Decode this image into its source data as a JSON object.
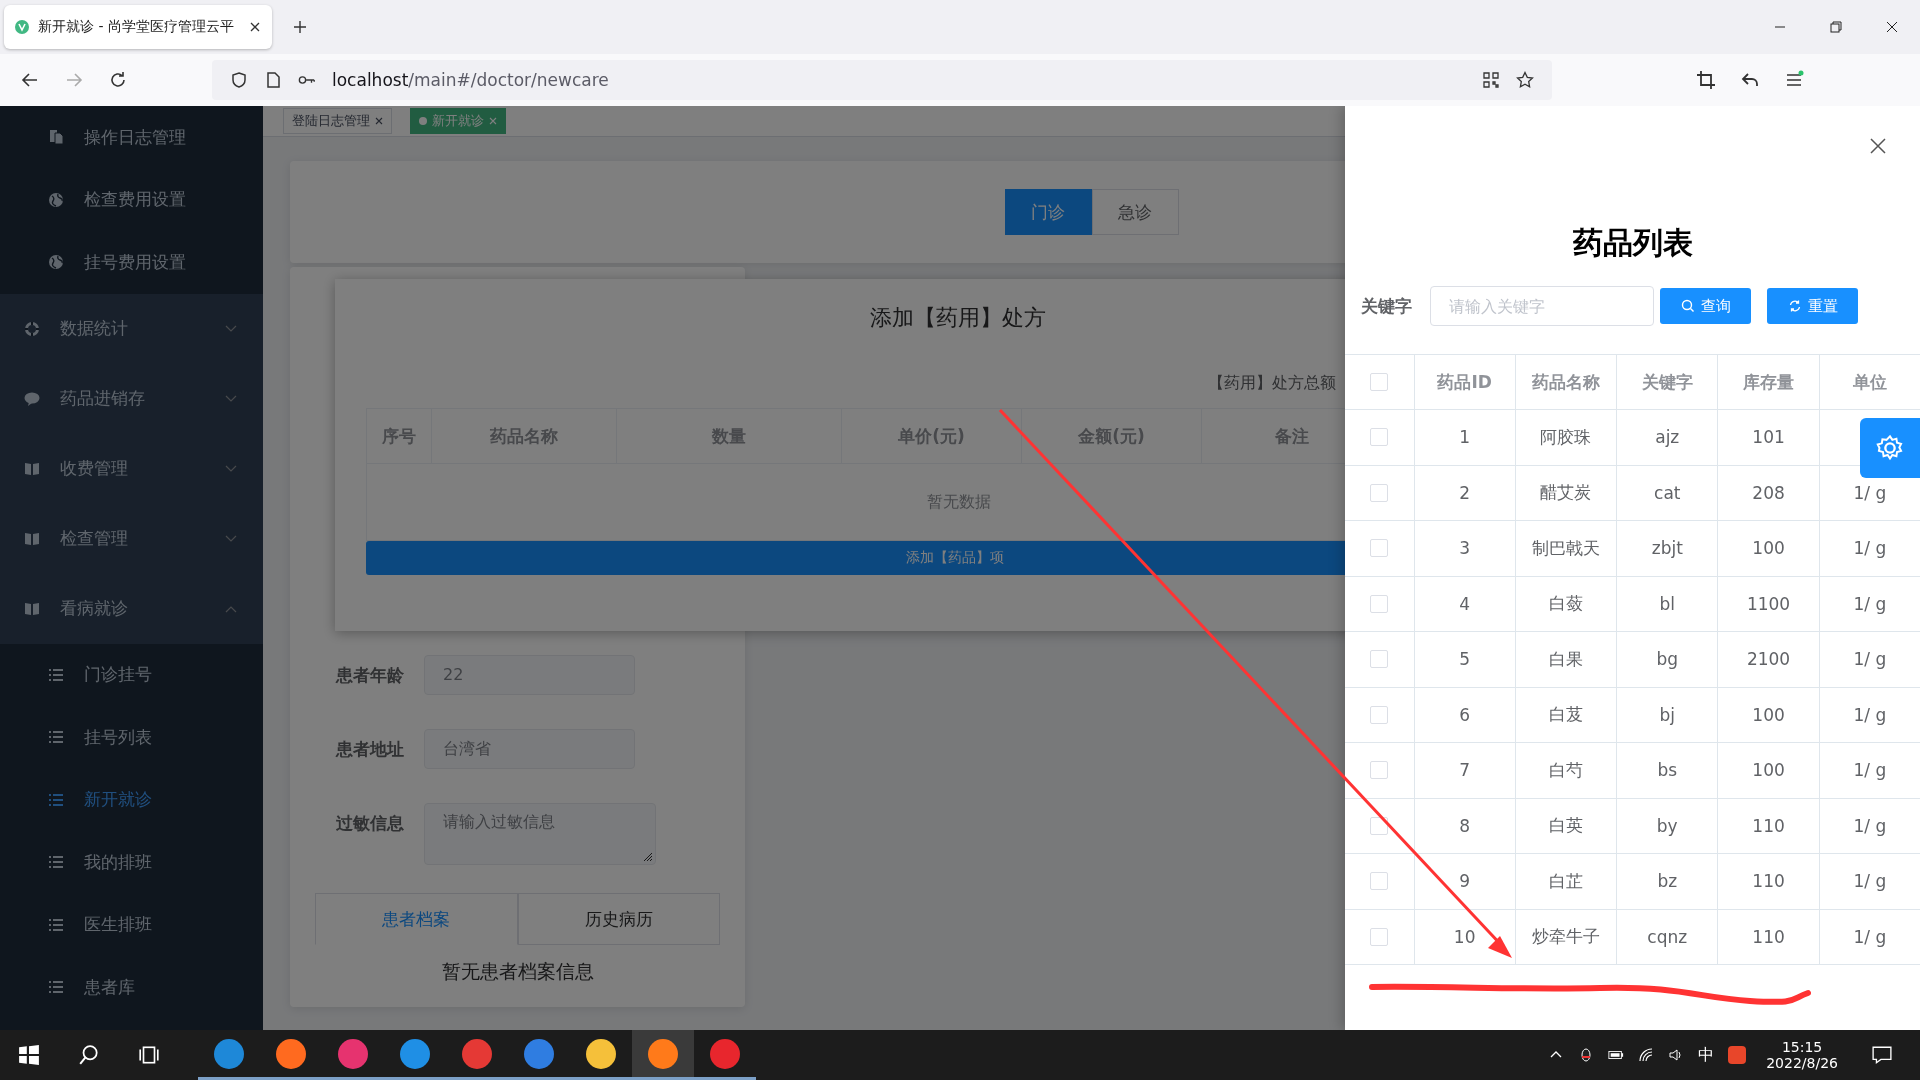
{
  "browser": {
    "tab_title": "新开就诊 - 尚学堂医疗管理云平",
    "url_host": "localhost",
    "url_path": "/main#/doctor/newcare"
  },
  "sidebar": {
    "items": [
      {
        "kind": "sub",
        "label": "操作日志管理",
        "selected": false
      },
      {
        "kind": "sub",
        "label": "检查费用设置",
        "selected": false
      },
      {
        "kind": "sub",
        "label": "挂号费用设置",
        "selected": false
      },
      {
        "kind": "group",
        "label": "数据统计",
        "expanded": false
      },
      {
        "kind": "group",
        "label": "药品进销存",
        "expanded": false
      },
      {
        "kind": "group",
        "label": "收费管理",
        "expanded": false
      },
      {
        "kind": "group",
        "label": "检查管理",
        "expanded": false
      },
      {
        "kind": "group",
        "label": "看病就诊",
        "expanded": true
      },
      {
        "kind": "sub",
        "label": "门诊挂号",
        "selected": false
      },
      {
        "kind": "sub",
        "label": "挂号列表",
        "selected": false
      },
      {
        "kind": "sub",
        "label": "新开就诊",
        "selected": true
      },
      {
        "kind": "sub",
        "label": "我的排班",
        "selected": false
      },
      {
        "kind": "sub",
        "label": "医生排班",
        "selected": false
      },
      {
        "kind": "sub",
        "label": "患者库",
        "selected": false
      }
    ]
  },
  "tags": [
    {
      "label": "登陆日志管理",
      "selected": false
    },
    {
      "label": "新开就诊",
      "selected": true
    }
  ],
  "visit_types": [
    {
      "label": "门诊",
      "selected": true
    },
    {
      "label": "急诊",
      "selected": false
    }
  ],
  "prescription_dialog": {
    "title": "添加【药用】处方",
    "total_label": "【药用】处方总额",
    "columns": [
      "序号",
      "药品名称",
      "数量",
      "单价(元)",
      "金额(元)",
      "备注"
    ],
    "empty_text": "暂无数据",
    "add_button": "添加【药品】项"
  },
  "patient_form": {
    "fields": [
      {
        "kind": "input",
        "label": "患者年龄",
        "value": "22"
      },
      {
        "kind": "input",
        "label": "患者地址",
        "value": "台湾省"
      },
      {
        "kind": "textarea",
        "label": "过敏信息",
        "placeholder": "请输入过敏信息"
      }
    ]
  },
  "patient_tabs": [
    {
      "label": "患者档案",
      "selected": true
    },
    {
      "label": "历史病历",
      "selected": false
    }
  ],
  "patient_empty_text": "暂无患者档案信息",
  "drawer": {
    "title": "药品列表",
    "search_label": "关键字",
    "search_placeholder": "请输入关键字",
    "buttons": [
      {
        "kind": "search",
        "label": "查询"
      },
      {
        "kind": "reset",
        "label": "重置"
      }
    ],
    "header_checked": false,
    "columns": [
      "药品ID",
      "药品名称",
      "关键字",
      "库存量",
      "单位"
    ],
    "rows": [
      {
        "checked": false,
        "cells": [
          "1",
          "阿胶珠",
          "ajz",
          "101",
          ""
        ]
      },
      {
        "checked": false,
        "cells": [
          "2",
          "醋艾炭",
          "cat",
          "208",
          "1/ g"
        ]
      },
      {
        "checked": false,
        "cells": [
          "3",
          "制巴戟天",
          "zbjt",
          "100",
          "1/ g"
        ]
      },
      {
        "checked": false,
        "cells": [
          "4",
          "白蔹",
          "bl",
          "1100",
          "1/ g"
        ]
      },
      {
        "checked": false,
        "cells": [
          "5",
          "白果",
          "bg",
          "2100",
          "1/ g"
        ]
      },
      {
        "checked": false,
        "cells": [
          "6",
          "白芨",
          "bj",
          "100",
          "1/ g"
        ]
      },
      {
        "checked": false,
        "cells": [
          "7",
          "白芍",
          "bs",
          "100",
          "1/ g"
        ]
      },
      {
        "checked": false,
        "cells": [
          "8",
          "白英",
          "by",
          "110",
          "1/ g"
        ]
      },
      {
        "checked": false,
        "cells": [
          "9",
          "白芷",
          "bz",
          "110",
          "1/ g"
        ]
      },
      {
        "checked": false,
        "cells": [
          "10",
          "炒牵牛子",
          "cqnz",
          "110",
          "1/ g"
        ]
      }
    ]
  },
  "taskbar": {
    "ime": "中",
    "time": "15:15",
    "date": "2022/8/26"
  }
}
